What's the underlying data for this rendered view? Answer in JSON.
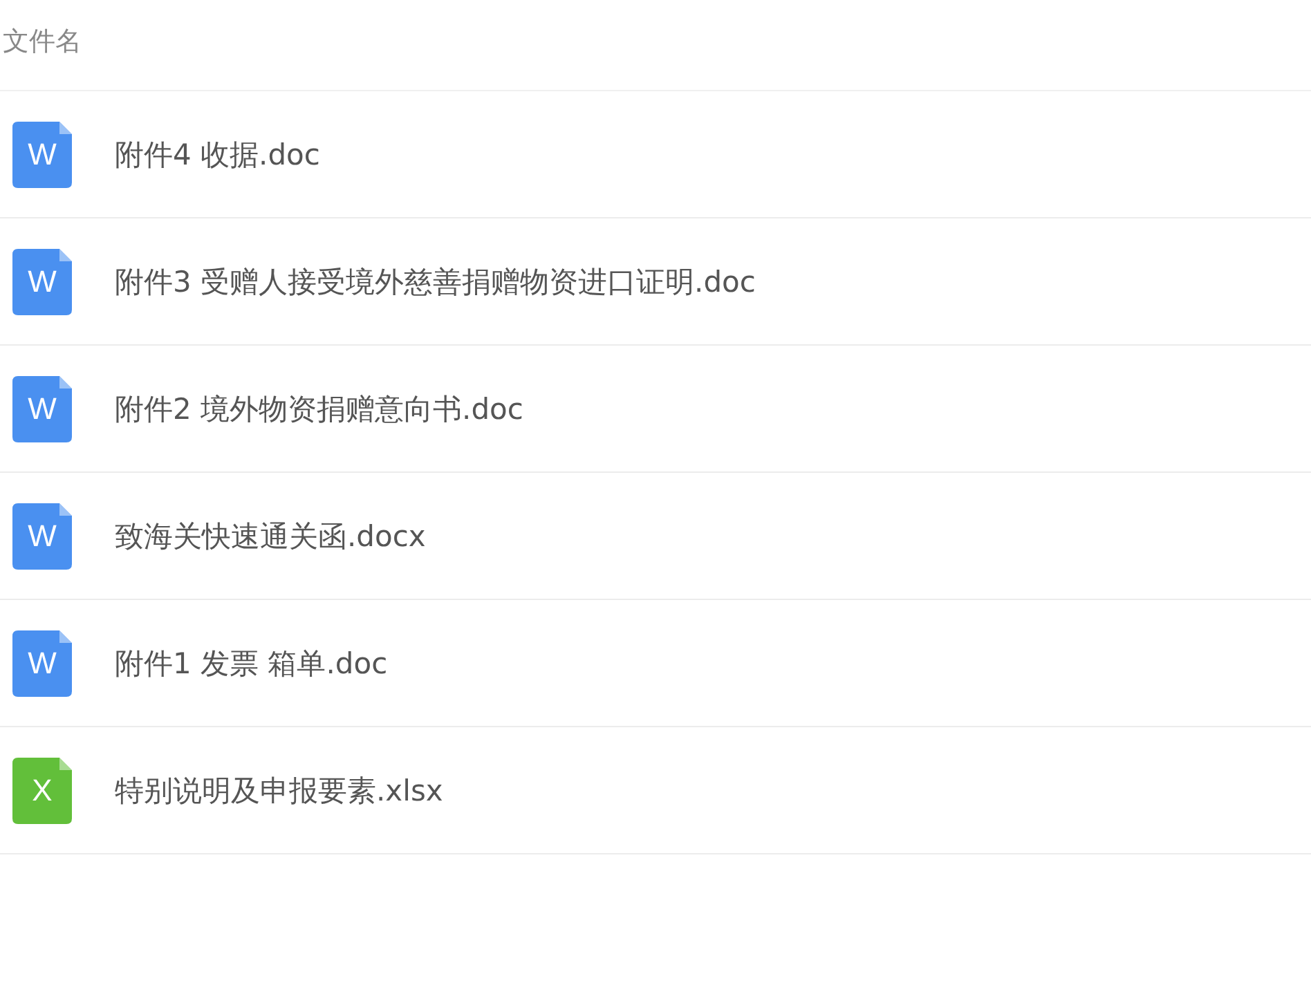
{
  "header": {
    "label": "文件名"
  },
  "files": [
    {
      "kind": "word",
      "icon_letter": "W",
      "name": "附件4 收据.doc"
    },
    {
      "kind": "word",
      "icon_letter": "W",
      "name": "附件3 受赠人接受境外慈善捐赠物资进口证明.doc"
    },
    {
      "kind": "word",
      "icon_letter": "W",
      "name": "附件2 境外物资捐赠意向书.doc"
    },
    {
      "kind": "word",
      "icon_letter": "W",
      "name": "致海关快速通关函.docx"
    },
    {
      "kind": "word",
      "icon_letter": "W",
      "name": "附件1 发票 箱单.doc"
    },
    {
      "kind": "excel",
      "icon_letter": "X",
      "name": "特别说明及申报要素.xlsx"
    }
  ]
}
